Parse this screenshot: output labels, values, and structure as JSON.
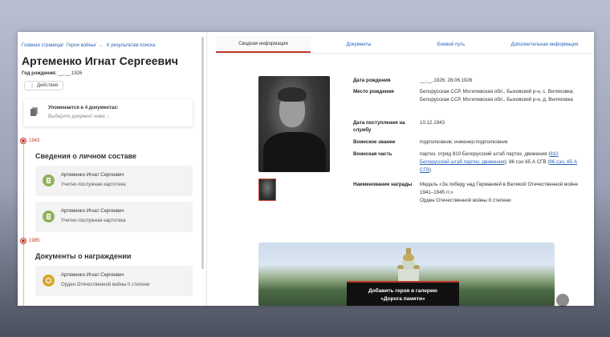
{
  "breadcrumbs": [
    "Главная страница/",
    "Герои войны/",
    "←",
    "К результатам поиска"
  ],
  "person": {
    "name": "Артеменко Игнат Сергеевич",
    "birth_label": "Год рождения:",
    "birth_value": "__.__.1926"
  },
  "actions_label": "Действия",
  "mentions": {
    "title": "Упоминается в 4 документах:",
    "subtitle": "Выберите документ ниже ↓"
  },
  "timeline": [
    {
      "year": "1943",
      "section": "Сведения о личном составе",
      "records": [
        {
          "name": "Артеменко Игнат Сергеевич",
          "type": "Учетно-послужная картотека"
        },
        {
          "name": "Артеменко Игнат Сергеевич",
          "type": "Учетно-послужная картотека"
        }
      ]
    },
    {
      "year": "1985",
      "section": "Документы о награждении",
      "records": [
        {
          "name": "Артеменко Игнат Сергеевич",
          "type": "Орден Отечественной войны II степени"
        }
      ]
    }
  ],
  "tabs": [
    "Сводная информация",
    "Документы",
    "Боевой путь",
    "Дополнительная информация"
  ],
  "details": {
    "birth_date_label": "Дата рождения",
    "birth_date_value": "__.__.1926; 28.06.1926",
    "birth_place_label": "Место рождения",
    "birth_place_value": "Белорусская ССР, Могилевская обл., Быховский р-н, с. Виляховка; Белорусская ССР, Могилевская обл., Быховский р-н, д. Виляховка",
    "service_date_label": "Дата поступления на службу",
    "service_date_value": "10.12.1943",
    "rank_label": "Воинское звание",
    "rank_value": "подполковник; инженер-подполковник",
    "unit_label": "Воинская часть",
    "unit_text_1": "партиз. отряд 810 Белорусский штаб партиз. движения (",
    "unit_link_1": "810 Белорусский штаб партиз. движения",
    "unit_text_2": "); 86 сэо 65 А СГВ (",
    "unit_link_2": "86 сэо, 65 А СГВ",
    "unit_text_3": ")",
    "awards_label": "Наименование награды",
    "awards_value_1": "Медаль «За победу над Германией в Великой Отечественной войне 1941–1945 гг.»",
    "awards_value_2": "Орден Отечественной войны II степени"
  },
  "gallery": {
    "line1": "Добавить героя в галерею",
    "line2": "«Дорога памяти»"
  },
  "colors": {
    "accent": "#c0392b",
    "link": "#2a63b8",
    "record_icon": "#8fb35a",
    "award_icon": "#d7a62a"
  }
}
